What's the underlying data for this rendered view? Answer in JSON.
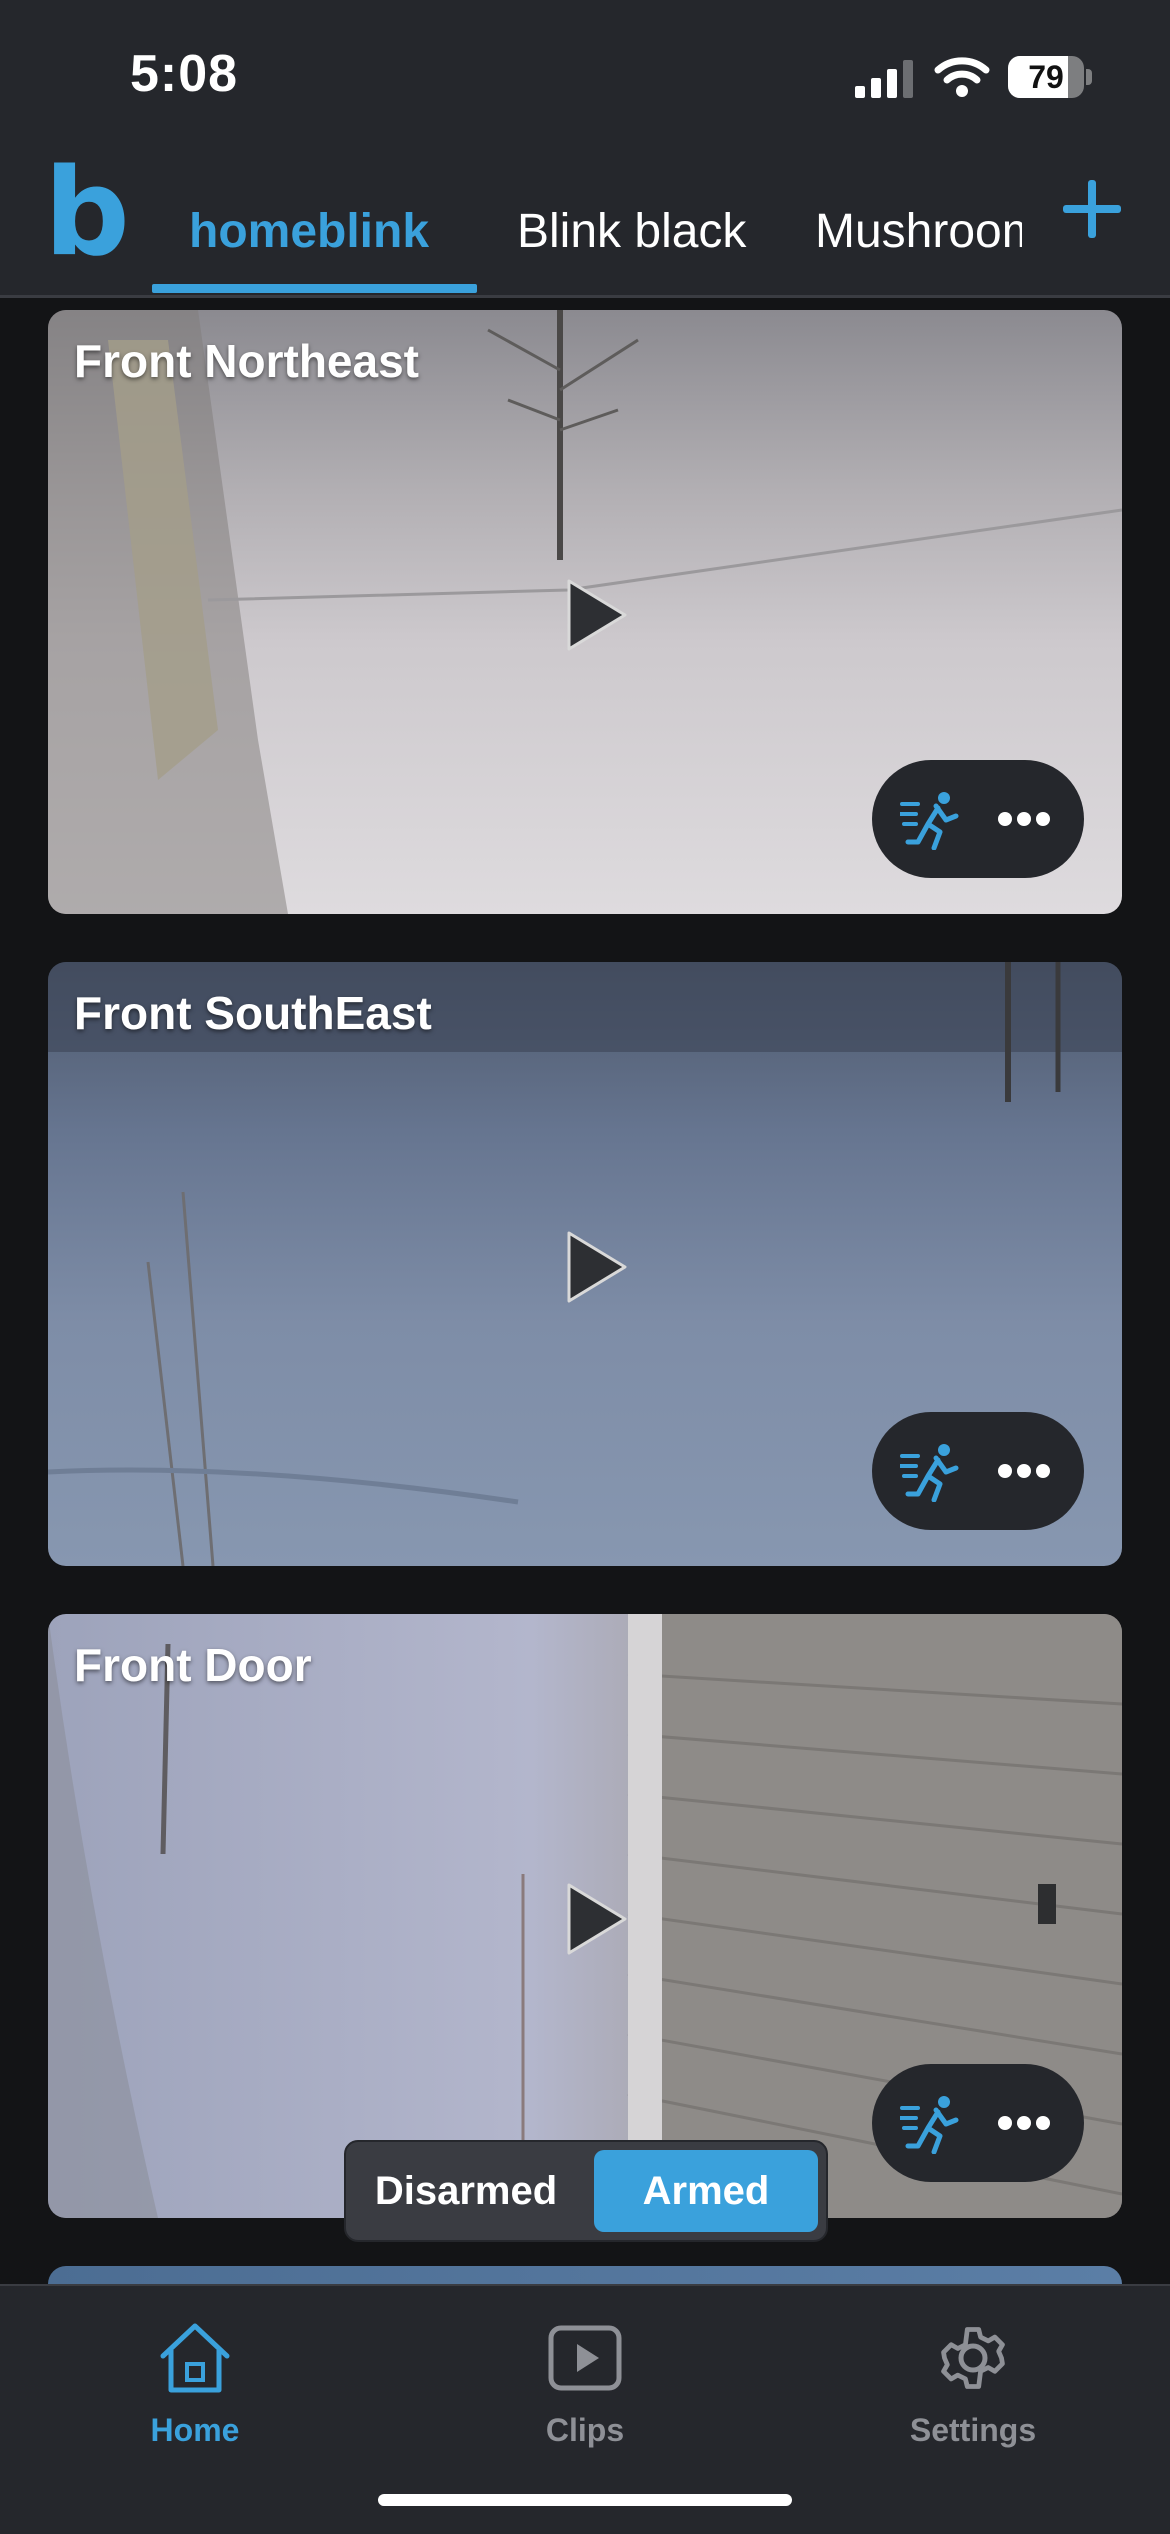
{
  "status_bar": {
    "time": "5:08",
    "battery": "79",
    "battery_level": 0.79
  },
  "header": {
    "logo": "b",
    "tabs": [
      {
        "label": "homeblink"
      },
      {
        "label": "Blink black"
      },
      {
        "label": "Mushroom"
      }
    ]
  },
  "cameras": [
    {
      "name": "Front Northeast"
    },
    {
      "name": "Front SouthEast"
    },
    {
      "name": "Front Door"
    }
  ],
  "arm_toggle": {
    "off_label": "Disarmed",
    "on_label": "Armed",
    "selected": "Armed"
  },
  "bottom_nav": {
    "items": [
      {
        "label": "Home",
        "icon": "home-icon",
        "active": true
      },
      {
        "label": "Clips",
        "icon": "play-square-icon",
        "active": false
      },
      {
        "label": "Settings",
        "icon": "gear-icon",
        "active": false
      }
    ]
  },
  "colors": {
    "accent": "#3aa1dc",
    "background": "#131416",
    "surface": "#25272c",
    "inactive": "#8e9096"
  }
}
